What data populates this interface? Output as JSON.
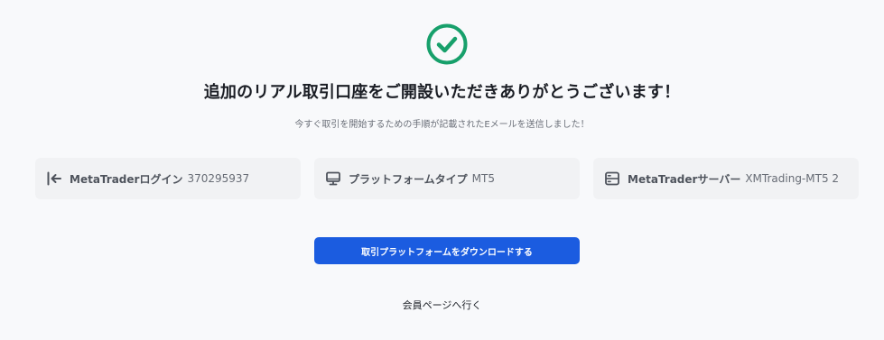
{
  "success": {
    "icon": "check-circle-icon",
    "color": "#17a06b"
  },
  "headline": "追加のリアル取引口座をご開設いただきありがとうございます！",
  "subtext": "今すぐ取引を開始するための手順が記載されたEメールを送信しました！",
  "cards": [
    {
      "icon": "login-arrow-icon",
      "label": "MetaTraderログイン",
      "value": "370295937"
    },
    {
      "icon": "monitor-icon",
      "label": "プラットフォームタイプ",
      "value": "MT5"
    },
    {
      "icon": "server-icon",
      "label": "MetaTraderサーバー",
      "value": "XMTrading-MT5 2"
    }
  ],
  "download_button": {
    "label": "取引プラットフォームをダウンロードする",
    "color": "#1b5ce0"
  },
  "member_link": "会員ページへ行く"
}
